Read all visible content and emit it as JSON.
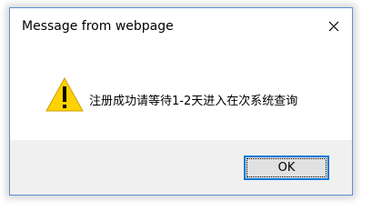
{
  "dialog": {
    "title": "Message from webpage",
    "close_icon": "close-icon",
    "message_icon": "warning-icon",
    "message": "注册成功请等待1-2天进入在次系统查询",
    "ok_label": "OK"
  },
  "colors": {
    "border": "#5c8fd6",
    "footer_bg": "#f0f0f0",
    "button_bg": "#e1e1e1",
    "button_focus": "#0078d7",
    "warning_fill": "#ffd200"
  }
}
